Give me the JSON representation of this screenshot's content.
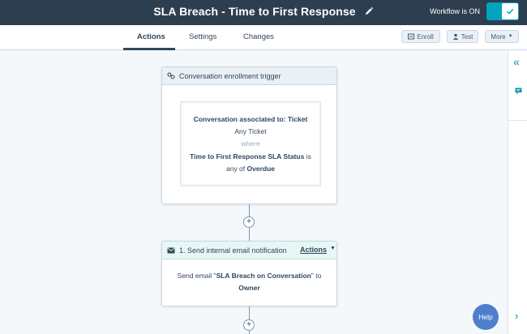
{
  "header": {
    "title": "SLA Breach - Time to First Response",
    "workflow_status": "Workflow is ON",
    "toggle_on": true
  },
  "tabs": [
    {
      "label": "Actions",
      "active": true
    },
    {
      "label": "Settings",
      "active": false
    },
    {
      "label": "Changes",
      "active": false
    }
  ],
  "toolbar": {
    "enroll_label": "Enroll",
    "test_label": "Test",
    "more_label": "More"
  },
  "trigger": {
    "label": "Conversation enrollment trigger",
    "assoc_prefix": "Conversation associated to: ",
    "assoc_object": "Ticket",
    "scope": "Any Ticket",
    "where": "where",
    "property": "Time to First Response SLA Status",
    "is_word": " is",
    "any_of": "any of ",
    "value": "Overdue"
  },
  "action": {
    "label": "1. Send internal email notification",
    "menu_label": "Actions",
    "body_prefix": "Send email \"",
    "email_name": "SLA Breach on Conversation",
    "body_suffix": "\" to",
    "recipient": "Owner"
  },
  "help_label": "Help",
  "icons": {
    "edit": "pencil-icon",
    "toggle_check": "check-icon",
    "enroll": "enroll-icon",
    "test": "person-icon",
    "more": "caret-down-icon",
    "trigger": "enrollment-trigger-icon",
    "action": "envelope-icon",
    "rail_collapse": "double-chevron-left-icon",
    "rail_comment": "comment-icon",
    "rail_next": "chevron-right-icon"
  },
  "colors": {
    "topbar": "#2d3e50",
    "toggle": "#00a4bd",
    "action_header": "#e5f8f6",
    "trigger_header": "#eaf0f6",
    "help": "#4f7fcb"
  }
}
